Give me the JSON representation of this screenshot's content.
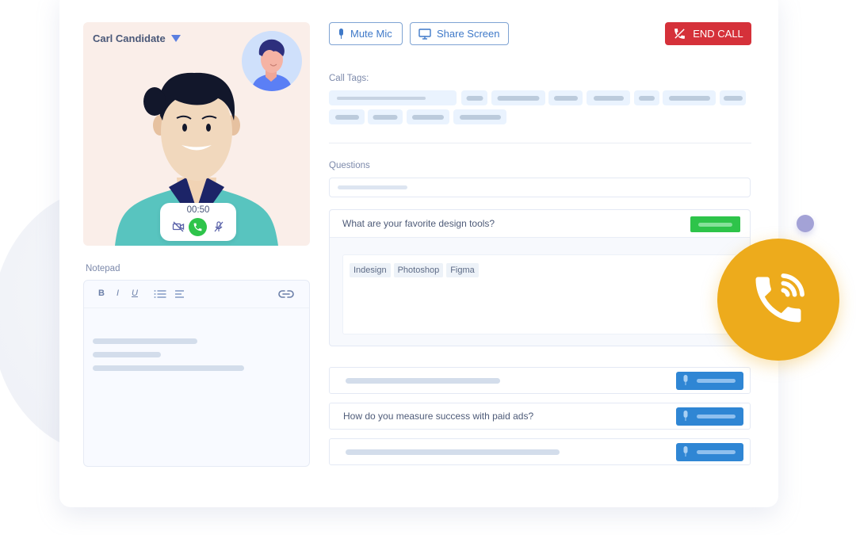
{
  "candidate": {
    "name": "Carl Candidate",
    "timer": "00:50"
  },
  "toolbar": {
    "mute_label": "Mute Mic",
    "share_label": "Share Screen",
    "end_call_label": "END CALL"
  },
  "call_tags": {
    "label": "Call Tags:",
    "tag_count": 13
  },
  "notepad": {
    "label": "Notepad",
    "toolbar": {
      "bold": "B",
      "italic": "I",
      "underline": "U"
    }
  },
  "questions": {
    "label": "Questions",
    "open_question": {
      "text": "What are your favorite design tools?",
      "answers": [
        "Indesign",
        "Photoshop",
        "Figma"
      ]
    },
    "list": [
      {
        "text": ""
      },
      {
        "text": "How do you measure success with paid ads?"
      },
      {
        "text": ""
      }
    ]
  },
  "colors": {
    "end_call": "#d5313a",
    "accent_blue": "#2f86d4",
    "success_green": "#2ec44a",
    "call_fab": "#edab1c"
  }
}
